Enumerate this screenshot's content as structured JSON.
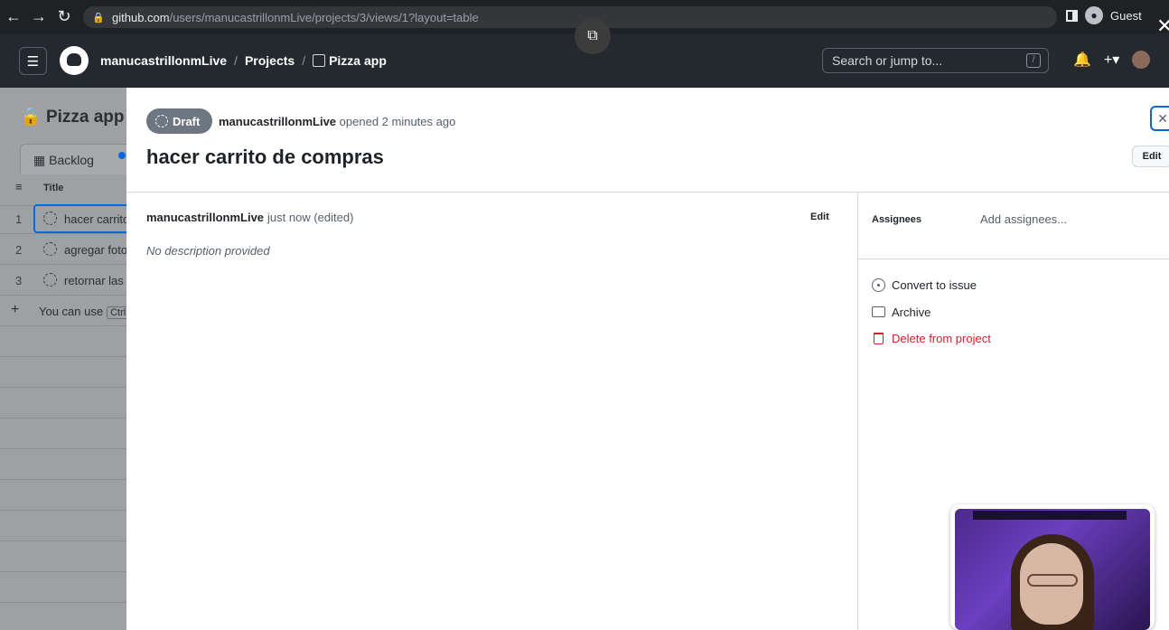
{
  "browser": {
    "url_host": "github.com",
    "url_path": "/users/manucastrillonmLive/projects/3/views/1?layout=table",
    "profile": "Guest"
  },
  "header": {
    "owner": "manucastrillonmLive",
    "projects": "Projects",
    "project_name": "Pizza app",
    "search_placeholder": "Search or jump to...",
    "search_shortcut": "/"
  },
  "project": {
    "name": "Pizza app",
    "view_tab": "Backlog",
    "column_title": "Title",
    "rows": [
      {
        "num": "1",
        "title": "hacer carrito de compras"
      },
      {
        "num": "2",
        "title": "agregar fotos"
      },
      {
        "num": "3",
        "title": "retornar las"
      }
    ],
    "add_hint": "You can use",
    "add_kbd": "Ctrl"
  },
  "panel": {
    "status": "Draft",
    "author": "manucastrillonmLive",
    "opened_text": "opened 2 minutes ago",
    "title": "hacer carrito de compras",
    "edit_label": "Edit",
    "comment_author": "manucastrillonmLive",
    "comment_time": "just now (edited)",
    "comment_edit": "Edit",
    "description": "No description provided",
    "assignees_label": "Assignees",
    "assignees_value": "Add assignees...",
    "actions": {
      "convert": "Convert to issue",
      "archive": "Archive",
      "delete": "Delete from project"
    }
  },
  "colors": {
    "header_bg": "#24292f",
    "accent": "#0969da",
    "danger": "#cf222e",
    "draft_badge": "#6e7781"
  }
}
